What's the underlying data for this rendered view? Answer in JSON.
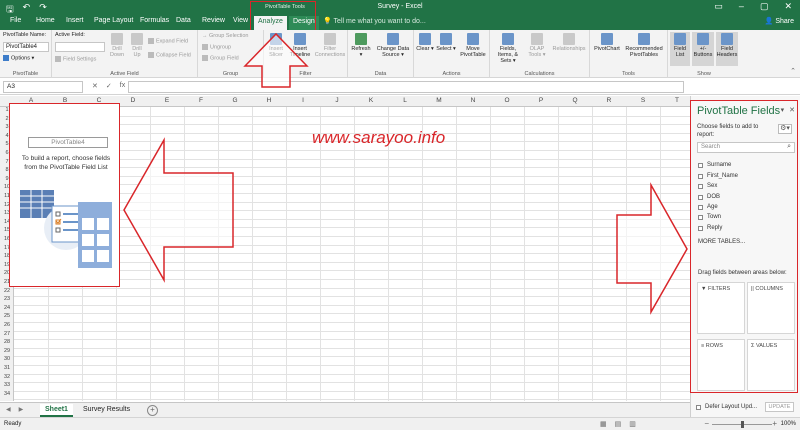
{
  "window": {
    "doc_title": "Survey - Excel",
    "context_title": "PivotTable Tools",
    "share_label": "Share",
    "tell_me": "Tell me what you want to do..."
  },
  "tabs": [
    "File",
    "Home",
    "Insert",
    "Page Layout",
    "Formulas",
    "Data",
    "Review",
    "View",
    "Analyze",
    "Design"
  ],
  "active_tab": "Analyze",
  "ribbon": {
    "pivottable": {
      "name_label": "PivotTable Name:",
      "name_value": "PivotTable4",
      "options_label": "Options",
      "group_label": "PivotTable"
    },
    "active_field": {
      "label": "Active Field:",
      "field_settings": "Field Settings",
      "drill_down": "Drill Down",
      "drill_up": "Drill Up",
      "expand_field": "Expand Field",
      "collapse_field": "Collapse Field",
      "group_label": "Active Field"
    },
    "group": {
      "group_selection": "Group Selection",
      "ungroup": "Ungroup",
      "group_field": "Group Field",
      "group_label": "Group"
    },
    "filter": {
      "insert_slicer": "Insert Slicer",
      "insert_timeline": "Insert Timeline",
      "filter_connections": "Filter Connections",
      "group_label": "Filter"
    },
    "data": {
      "refresh": "Refresh",
      "change_data_source": "Change Data Source",
      "group_label": "Data"
    },
    "actions": {
      "clear": "Clear",
      "select": "Select",
      "move_pivottable": "Move PivotTable",
      "group_label": "Actions"
    },
    "calculations": {
      "fields_items_sets": "Fields, Items, & Sets",
      "olap_tools": "OLAP Tools",
      "relationships": "Relationships",
      "group_label": "Calculations"
    },
    "tools": {
      "pivotchart": "PivotChart",
      "recommended_pivottables": "Recommended PivotTables",
      "group_label": "Tools"
    },
    "show": {
      "field_list": "Field List",
      "buttons": "+/- Buttons",
      "field_headers": "Field Headers",
      "group_label": "Show"
    }
  },
  "formula_bar": {
    "name_box": "A3",
    "fx": "fx",
    "cancel": "✕",
    "enter": "✓"
  },
  "columns": [
    "A",
    "B",
    "C",
    "D",
    "E",
    "F",
    "G",
    "H",
    "I",
    "J",
    "K",
    "L",
    "M",
    "N",
    "O",
    "P",
    "Q",
    "R",
    "S",
    "T"
  ],
  "rows": [
    "1",
    "2",
    "3",
    "4",
    "5",
    "6",
    "7",
    "8",
    "9",
    "10",
    "11",
    "12",
    "13",
    "14",
    "15",
    "16",
    "17",
    "18",
    "19",
    "20",
    "21",
    "22",
    "23",
    "24",
    "25",
    "26",
    "27",
    "28",
    "29",
    "30",
    "31",
    "32",
    "33",
    "34"
  ],
  "pivot_placeholder": {
    "name": "PivotTable4",
    "instructions": "To build a report, choose fields from the PivotTable Field List"
  },
  "watermark": "www.sarayoo.info",
  "sheets": [
    "Sheet1",
    "Survey Results"
  ],
  "active_sheet": "Sheet1",
  "status": {
    "ready": "Ready",
    "zoom": "100%"
  },
  "field_pane": {
    "title": "PivotTable Fields",
    "choose_label": "Choose fields to add to report:",
    "search_placeholder": "Search",
    "fields": [
      "Surname",
      "First_Name",
      "Sex",
      "DOB",
      "Age",
      "Town",
      "Reply"
    ],
    "more_tables": "MORE TABLES...",
    "drag_label": "Drag fields between areas below:",
    "areas": {
      "filters": "FILTERS",
      "columns": "COLUMNS",
      "rows": "ROWS",
      "values": "VALUES"
    },
    "defer_label": "Defer Layout Upd...",
    "update_label": "UPDATE"
  },
  "colors": {
    "excel_green": "#217346",
    "annotation_red": "#d9262a"
  }
}
